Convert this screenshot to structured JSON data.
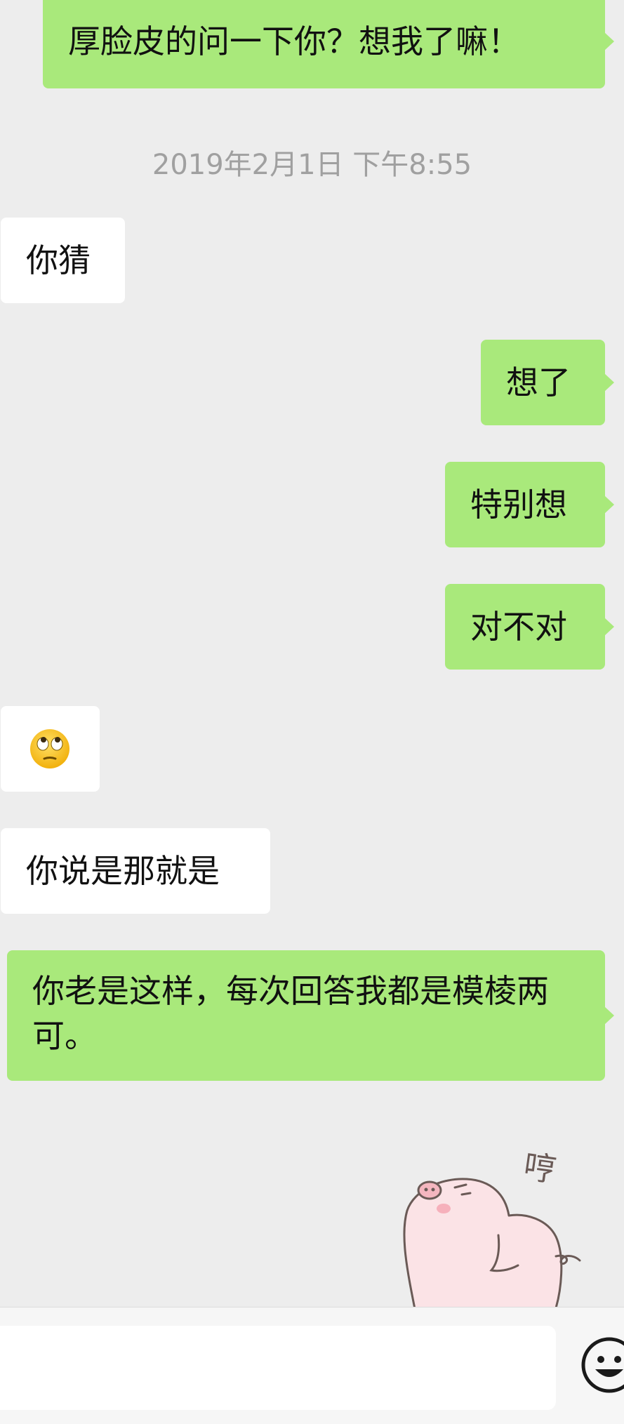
{
  "conversation": {
    "messages": [
      {
        "sender": "me",
        "text": "厚脸皮的问一下你？想我了嘛！"
      },
      {
        "sender": "them",
        "text": "你猜"
      },
      {
        "sender": "me",
        "text": "想了"
      },
      {
        "sender": "me",
        "text": "特别想"
      },
      {
        "sender": "me",
        "text": "对不对"
      },
      {
        "sender": "them",
        "emoji": "face-with-rolling-eyes"
      },
      {
        "sender": "them",
        "text": "你说是那就是"
      },
      {
        "sender": "me",
        "text": "你老是这样，每次回答我都是模棱两可。"
      },
      {
        "sender": "me",
        "sticker": "pig-hmph-sticker",
        "sticker_text": "哼"
      }
    ],
    "timestamp": "2019年2月1日 下午8:55"
  },
  "input_bar": {
    "value": "",
    "emoji_button_icon": "smiley-face-icon"
  },
  "colors": {
    "background": "#ededed",
    "my_bubble": "#a9e97b",
    "their_bubble": "#ffffff",
    "timestamp_text": "#a0a0a0"
  }
}
